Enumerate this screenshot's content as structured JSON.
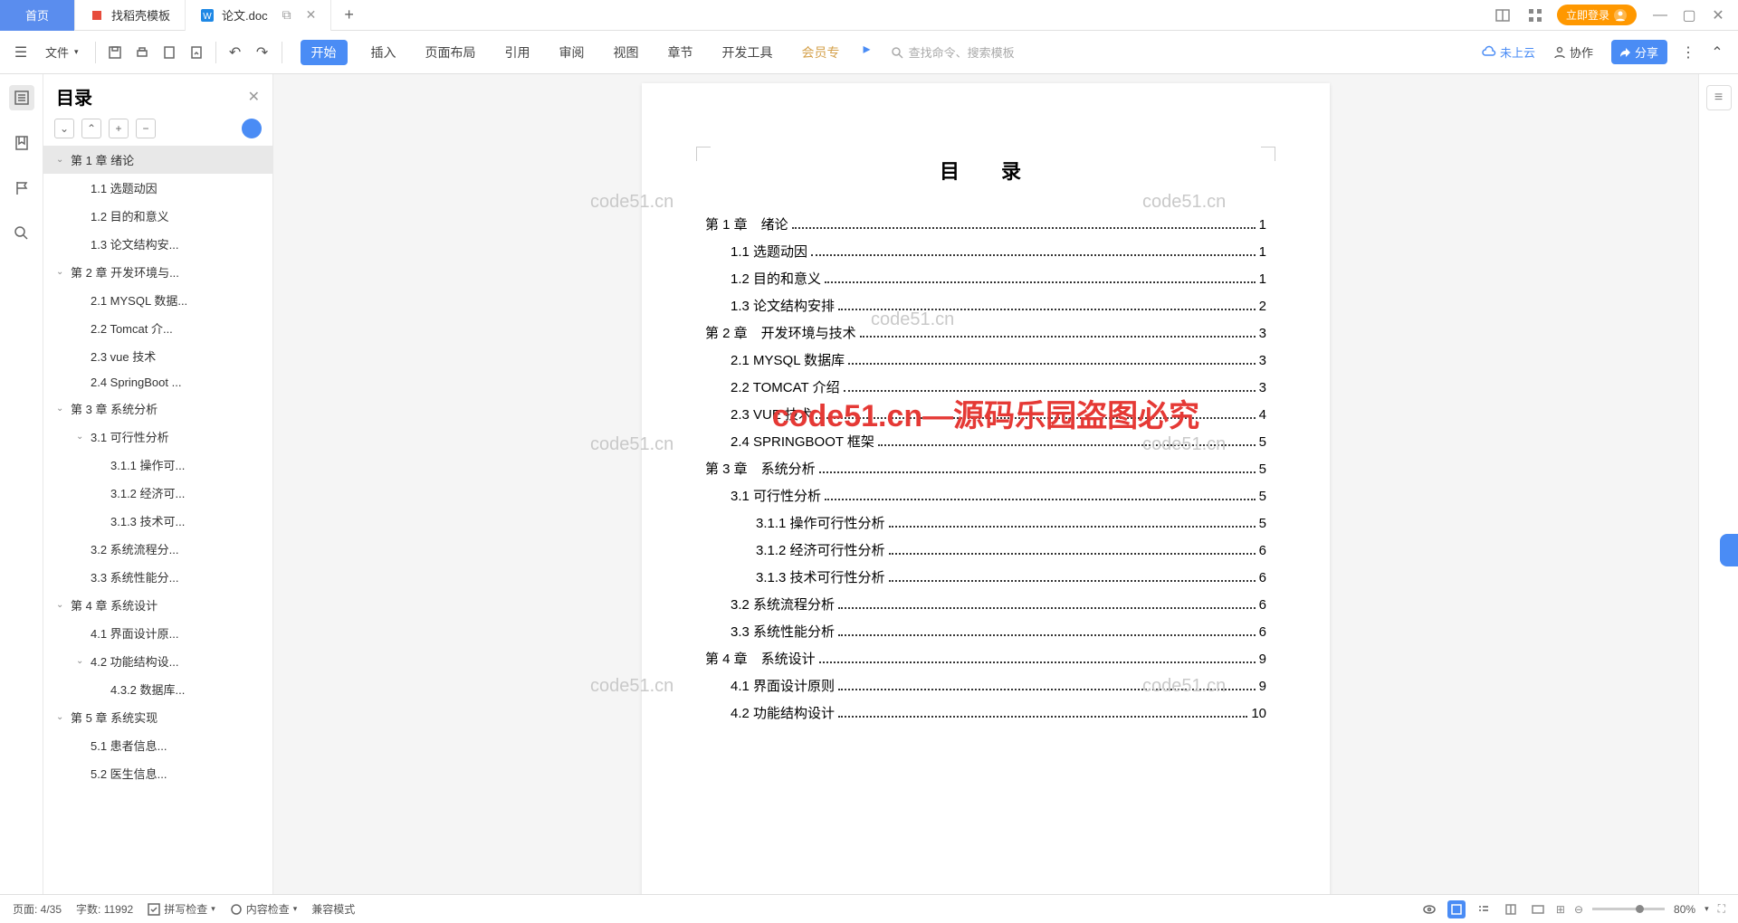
{
  "titlebar": {
    "home": "首页",
    "tabs": [
      {
        "label": "找稻壳模板",
        "icon": "red"
      },
      {
        "label": "论文.doc",
        "icon": "blue",
        "active": true
      }
    ],
    "login": "立即登录"
  },
  "toolbar": {
    "file": "文件",
    "menus": [
      "开始",
      "插入",
      "页面布局",
      "引用",
      "审阅",
      "视图",
      "章节",
      "开发工具",
      "会员专"
    ],
    "search_placeholder": "查找命令、搜索模板",
    "cloud": "未上云",
    "collab": "协作",
    "share": "分享"
  },
  "outline": {
    "title": "目录",
    "items": [
      {
        "level": 1,
        "label": "第 1 章 绪论",
        "selected": true,
        "chevron": true
      },
      {
        "level": 2,
        "label": "1.1 选题动因"
      },
      {
        "level": 2,
        "label": "1.2 目的和意义"
      },
      {
        "level": 2,
        "label": "1.3 论文结构安..."
      },
      {
        "level": 1,
        "label": "第 2 章 开发环境与...",
        "chevron": true
      },
      {
        "level": 2,
        "label": "2.1 MYSQL 数据..."
      },
      {
        "level": 2,
        "label": "2.2 Tomcat 介..."
      },
      {
        "level": 2,
        "label": "2.3 vue 技术"
      },
      {
        "level": 2,
        "label": "2.4 SpringBoot ..."
      },
      {
        "level": 1,
        "label": "第 3 章 系统分析",
        "chevron": true
      },
      {
        "level": 2,
        "label": "3.1 可行性分析",
        "chevron": true
      },
      {
        "level": 3,
        "label": "3.1.1 操作可..."
      },
      {
        "level": 3,
        "label": "3.1.2 经济可..."
      },
      {
        "level": 3,
        "label": "3.1.3 技术可..."
      },
      {
        "level": 2,
        "label": "3.2 系统流程分..."
      },
      {
        "level": 2,
        "label": "3.3 系统性能分..."
      },
      {
        "level": 1,
        "label": "第 4 章 系统设计",
        "chevron": true
      },
      {
        "level": 2,
        "label": "4.1 界面设计原..."
      },
      {
        "level": 2,
        "label": "4.2 功能结构设...",
        "chevron": true
      },
      {
        "level": 3,
        "label": "4.3.2 数据库..."
      },
      {
        "level": 1,
        "label": "第 5 章 系统实现",
        "chevron": true
      },
      {
        "level": 2,
        "label": "5.1 患者信息..."
      },
      {
        "level": 2,
        "label": "5.2 医生信息..."
      }
    ]
  },
  "document": {
    "title": "目　录",
    "red_watermark": "code51.cn—源码乐园盗图必究",
    "grey_watermark": "code51.cn",
    "toc": [
      {
        "level": 1,
        "text": "第 1 章　绪论",
        "page": "1"
      },
      {
        "level": 2,
        "text": "1.1 选题动因",
        "page": "1"
      },
      {
        "level": 2,
        "text": "1.2 目的和意义",
        "page": "1"
      },
      {
        "level": 2,
        "text": "1.3 论文结构安排",
        "page": "2"
      },
      {
        "level": 1,
        "text": "第 2 章　开发环境与技术",
        "page": "3"
      },
      {
        "level": 2,
        "text": "2.1 MYSQL 数据库",
        "page": "3"
      },
      {
        "level": 2,
        "text": "2.2 TOMCAT 介绍",
        "page": "3"
      },
      {
        "level": 2,
        "text": "2.3 VUE 技术",
        "page": "4"
      },
      {
        "level": 2,
        "text": "2.4 SPRINGBOOT 框架",
        "page": "5"
      },
      {
        "level": 1,
        "text": "第 3 章　系统分析",
        "page": "5"
      },
      {
        "level": 2,
        "text": "3.1 可行性分析",
        "page": "5"
      },
      {
        "level": 3,
        "text": "3.1.1 操作可行性分析",
        "page": "5"
      },
      {
        "level": 3,
        "text": "3.1.2 经济可行性分析",
        "page": "6"
      },
      {
        "level": 3,
        "text": "3.1.3 技术可行性分析",
        "page": "6"
      },
      {
        "level": 2,
        "text": "3.2 系统流程分析",
        "page": "6"
      },
      {
        "level": 2,
        "text": "3.3 系统性能分析",
        "page": "6"
      },
      {
        "level": 1,
        "text": "第 4 章　系统设计",
        "page": "9"
      },
      {
        "level": 2,
        "text": "4.1 界面设计原则",
        "page": "9"
      },
      {
        "level": 2,
        "text": "4.2 功能结构设计",
        "page": "10"
      }
    ]
  },
  "statusbar": {
    "page": "页面: 4/35",
    "words": "字数: 11992",
    "spellcheck": "拼写检查",
    "contentcheck": "内容检查",
    "compat": "兼容模式",
    "zoom": "80%"
  }
}
